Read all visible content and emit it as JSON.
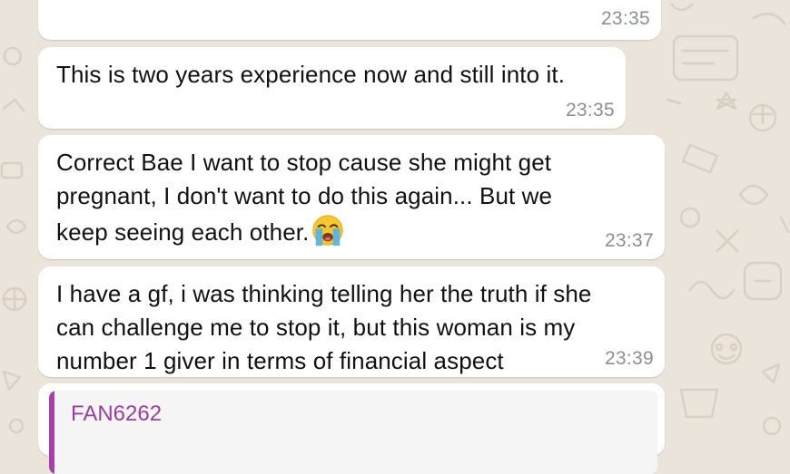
{
  "chat": {
    "messages": [
      {
        "text": "",
        "time": "23:35"
      },
      {
        "text": "This is two years experience now and still into it.",
        "time": "23:35"
      },
      {
        "text": "Correct Bae I want to stop cause she might get\npregnant, I don't want to do this again... But we\nkeep seeing each other.",
        "emoji": "loudly-crying-face-icon",
        "time": "23:37"
      },
      {
        "text": "I have a gf, i was thinking telling her the truth if she\ncan challenge me to stop it, but this woman is my\nnumber 1 giver in terms of financial aspect",
        "time": "23:39"
      }
    ],
    "quoted_message": {
      "sender": "FAN6262",
      "text": "",
      "sender_color": "#9a3e9e"
    }
  },
  "colors": {
    "wallpaper": "#ebe4da",
    "bubble": "#ffffff",
    "timestamp": "#8a8f92",
    "quote_bar": "#a640a8"
  }
}
